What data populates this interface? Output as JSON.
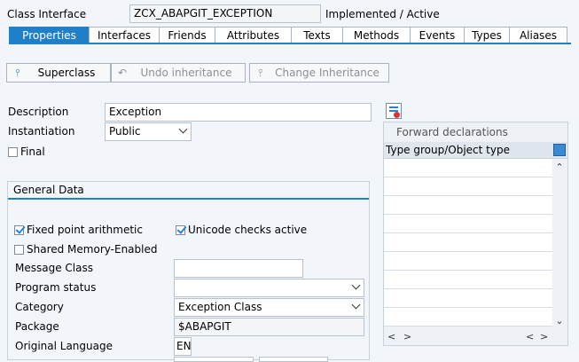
{
  "header": {
    "label": "Class Interface",
    "class_name": "ZCX_ABAPGIT_EXCEPTION",
    "status": "Implemented / Active"
  },
  "tabs": [
    {
      "label": "Properties",
      "active": true
    },
    {
      "label": "Interfaces"
    },
    {
      "label": "Friends"
    },
    {
      "label": "Attributes"
    },
    {
      "label": "Texts"
    },
    {
      "label": "Methods"
    },
    {
      "label": "Events"
    },
    {
      "label": "Types"
    },
    {
      "label": "Aliases"
    }
  ],
  "toolbar": {
    "superclass": "Superclass",
    "undo_inheritance": "Undo inheritance",
    "change_inheritance": "Change Inheritance"
  },
  "form": {
    "description_label": "Description",
    "description_value": "Exception",
    "instantiation_label": "Instantiation",
    "instantiation_value": "Public",
    "final_label": "Final"
  },
  "general": {
    "title": "General Data",
    "fixed_point_label": "Fixed point arithmetic",
    "unicode_label": "Unicode checks active",
    "shared_memory_label": "Shared Memory-Enabled",
    "message_class_label": "Message Class",
    "message_class_value": "",
    "program_status_label": "Program status",
    "program_status_value": "",
    "category_label": "Category",
    "category_value": "Exception Class",
    "package_label": "Package",
    "package_value": "$ABAPGIT",
    "orig_lang_label": "Original Language",
    "orig_lang_value": "EN"
  },
  "forward": {
    "title": "Forward declarations",
    "column": "Type group/Object type"
  }
}
